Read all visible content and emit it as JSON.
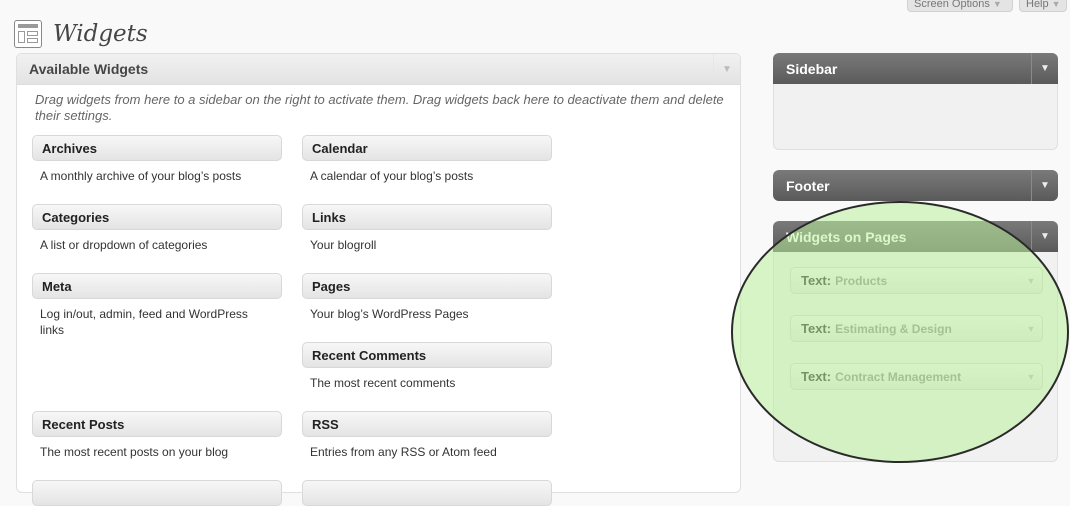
{
  "header": {
    "title": "Widgets",
    "screen_options_label": "Screen Options",
    "help_label": "Help"
  },
  "available": {
    "title": "Available Widgets",
    "description": "Drag widgets from here to a sidebar on the right to activate them. Drag widgets back here to deactivate them and delete their settings.",
    "widgets": [
      {
        "title": "Archives",
        "desc": "A monthly archive of your blog’s posts"
      },
      {
        "title": "Calendar",
        "desc": "A calendar of your blog’s posts"
      },
      {
        "title": "Categories",
        "desc": "A list or dropdown of categories"
      },
      {
        "title": "Links",
        "desc": "Your blogroll"
      },
      {
        "title": "Meta",
        "desc": "Log in/out, admin, feed and WordPress links"
      },
      {
        "title": "Pages",
        "desc": "Your blog’s WordPress Pages"
      },
      {
        "title": "Recent Comments",
        "desc": "The most recent comments"
      },
      {
        "title": "Recent Posts",
        "desc": "The most recent posts on your blog"
      },
      {
        "title": "RSS",
        "desc": "Entries from any RSS or Atom feed"
      }
    ]
  },
  "sidebars": {
    "sidebar": {
      "title": "Sidebar"
    },
    "footer": {
      "title": "Footer"
    },
    "widgets_on_pages": {
      "title": "Widgets on Pages",
      "items": [
        {
          "type": "Text:",
          "name": "Products"
        },
        {
          "type": "Text:",
          "name": "Estimating & Design"
        },
        {
          "type": "Text:",
          "name": "Contract Management"
        }
      ]
    }
  },
  "colors": {
    "highlight_fill": "#bbf09e",
    "sidebar_header": "#5a5a5a"
  }
}
